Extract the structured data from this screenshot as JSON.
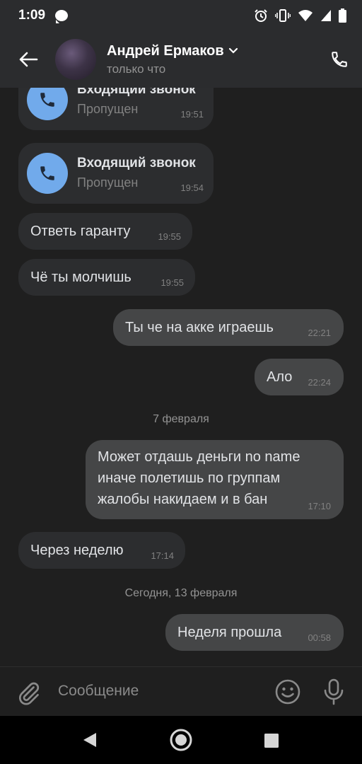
{
  "status_bar": {
    "time": "1:09"
  },
  "header": {
    "contact_name": "Андрей Ермаков",
    "contact_status": "только что"
  },
  "messages": {
    "call1": {
      "title": "Входящий звонок",
      "subtitle": "Пропущен",
      "time": "19:51"
    },
    "call2": {
      "title": "Входящий звонок",
      "subtitle": "Пропущен",
      "time": "19:54"
    },
    "m1": {
      "text": "Ответь гаранту",
      "time": "19:55"
    },
    "m2": {
      "text": "Чё ты молчишь",
      "time": "19:55"
    },
    "m3": {
      "text": "Ты че на акке играешь",
      "time": "22:21"
    },
    "m4": {
      "text": "Ало",
      "time": "22:24"
    },
    "date1": "7 февраля",
    "m5": {
      "line1": "Может отдашь деньги no name",
      "line2": "иначе полетишь по группам",
      "line3": "жалобы накидаем и в бан",
      "time": "17:10"
    },
    "m6": {
      "text": "Через неделю",
      "time": "17:14"
    },
    "date2": "Сегодня, 13 февраля",
    "m7": {
      "text": "Неделя прошла",
      "time": "00:58"
    }
  },
  "composer": {
    "placeholder": "Сообщение"
  },
  "colors": {
    "background": "#1f1f1f",
    "header": "#2b2c2e",
    "incoming_bubble": "#2c2d2f",
    "outgoing_bubble": "#454647",
    "call_accent": "#71aaeb"
  }
}
